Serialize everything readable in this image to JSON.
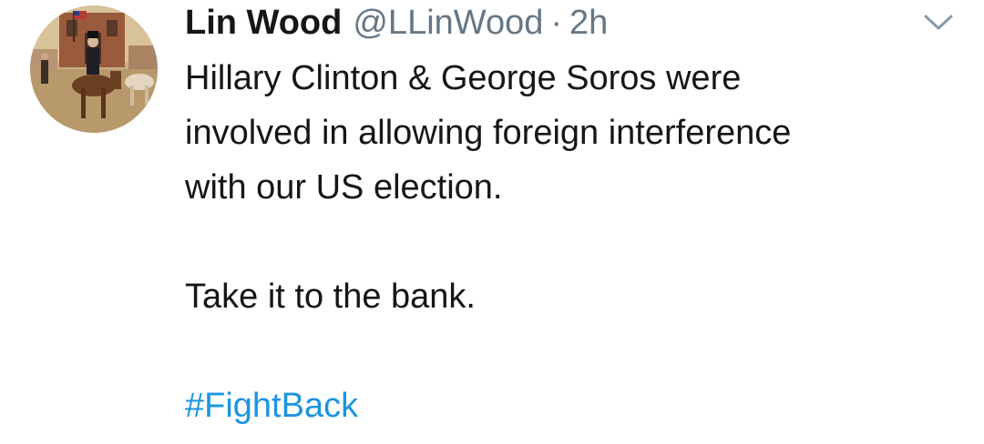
{
  "tweet": {
    "author": {
      "display_name": "Lin Wood",
      "handle": "@LLinWood",
      "separator": "·",
      "time": "2h"
    },
    "lines_paragraph_1": [
      "Hillary Clinton & George Soros were",
      "involved in allowing foreign interference",
      "with our US election."
    ],
    "paragraph_2": "Take it to the bank.",
    "hashtag": "#FightBack",
    "menu_icon": "chevron-down-icon"
  },
  "colors": {
    "text": "#14171a",
    "secondary": "#657786",
    "link": "#1b95e0"
  }
}
